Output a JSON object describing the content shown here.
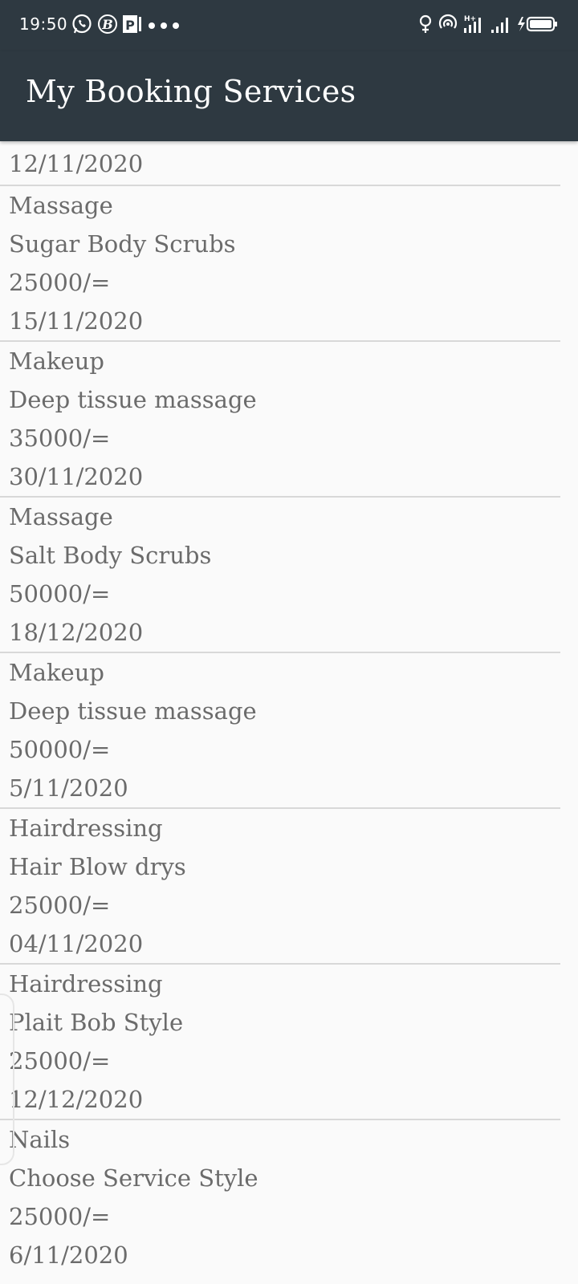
{
  "status_bar": {
    "time": "19:50",
    "left_icons": [
      "whatsapp-icon",
      "b-app-icon",
      "parking-app-icon",
      "more-dots-icon"
    ],
    "right_icons": [
      "female-icon",
      "hotspot-icon",
      "signal-4g-icon",
      "signal-icon",
      "battery-charging-icon"
    ]
  },
  "app_bar": {
    "title": "My Booking Services"
  },
  "list": {
    "first_date": "12/11/2020",
    "bookings": [
      {
        "category": "Massage",
        "service": "Sugar Body Scrubs",
        "price": "25000/=",
        "date": "15/11/2020"
      },
      {
        "category": "Makeup",
        "service": "Deep tissue massage",
        "price": "35000/=",
        "date": "30/11/2020"
      },
      {
        "category": "Massage",
        "service": "Salt Body Scrubs",
        "price": "50000/=",
        "date": "18/12/2020"
      },
      {
        "category": "Makeup",
        "service": "Deep tissue massage",
        "price": "50000/=",
        "date": "5/11/2020"
      },
      {
        "category": "Hairdressing",
        "service": "Hair Blow drys",
        "price": "25000/=",
        "date": "04/11/2020"
      },
      {
        "category": "Hairdressing",
        "service": "Plait Bob Style",
        "price": "25000/=",
        "date": "12/12/2020"
      },
      {
        "category": "Nails",
        "service": "Choose Service Style",
        "price": "25000/=",
        "date": "6/11/2020"
      }
    ]
  },
  "colors": {
    "toolbar": "#2e3941",
    "background": "#fafafa",
    "text": "#6b6b6b",
    "divider": "#d8d8d8"
  }
}
